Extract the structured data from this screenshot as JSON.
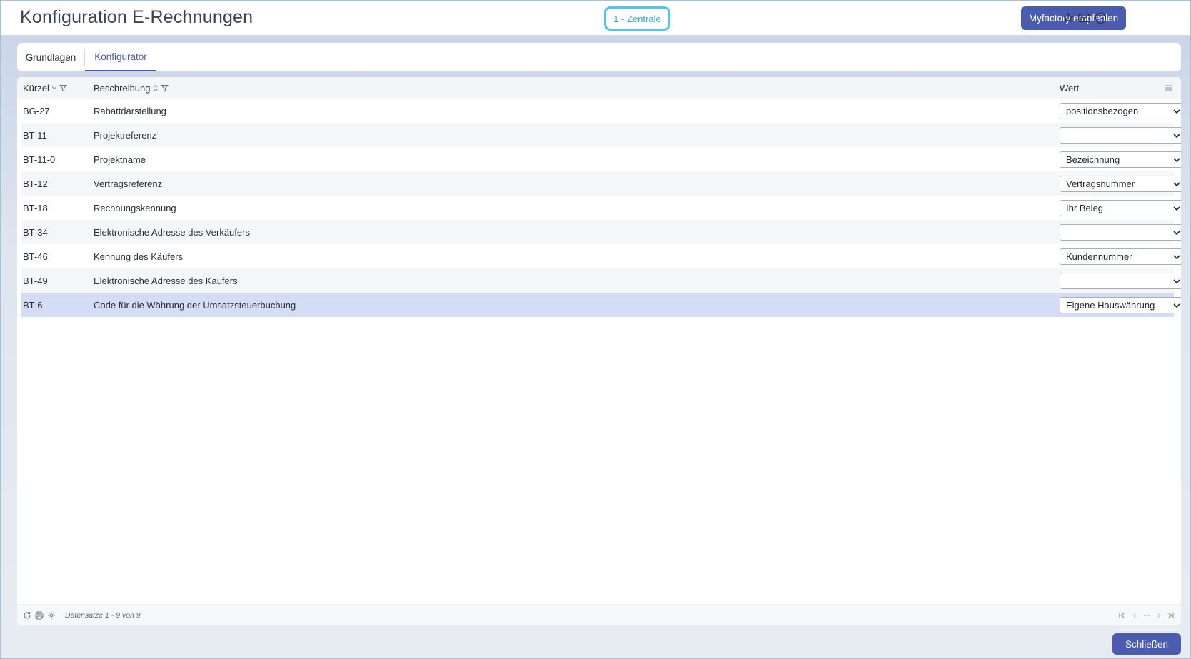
{
  "header": {
    "title": "Konfiguration E-Rechnungen",
    "location": "1 - Zentrale",
    "recommend_label": "Myfactory empfehlen",
    "icons": [
      "star-icon",
      "mail-icon",
      "help-icon"
    ]
  },
  "tabs": [
    {
      "label": "Grundlagen",
      "active": false
    },
    {
      "label": "Konfigurator",
      "active": true
    }
  ],
  "grid": {
    "columns": {
      "kurzel": "Kürzel",
      "beschreibung": "Beschreibung",
      "wert": "Wert"
    },
    "rows": [
      {
        "kurzel": "BG-27",
        "beschreibung": "Rabattdarstellung",
        "wert": "positionsbezogen"
      },
      {
        "kurzel": "BT-11",
        "beschreibung": "Projektreferenz",
        "wert": ""
      },
      {
        "kurzel": "BT-11-0",
        "beschreibung": "Projektname",
        "wert": "Bezeichnung"
      },
      {
        "kurzel": "BT-12",
        "beschreibung": "Vertragsreferenz",
        "wert": "Vertragsnummer"
      },
      {
        "kurzel": "BT-18",
        "beschreibung": "Rechnungskennung",
        "wert": "Ihr Beleg"
      },
      {
        "kurzel": "BT-34",
        "beschreibung": "Elektronische Adresse des Verkäufers",
        "wert": ""
      },
      {
        "kurzel": "BT-46",
        "beschreibung": "Kennung des Käufers",
        "wert": "Kundennummer"
      },
      {
        "kurzel": "BT-49",
        "beschreibung": "Elektronische Adresse des Käufers",
        "wert": ""
      },
      {
        "kurzel": "BT-6",
        "beschreibung": "Code für die Währung der Umsatzsteuerbuchung",
        "wert": "Eigene Hauswährung"
      }
    ],
    "selected_row": 8,
    "record_count": "Datensätze 1 - 9 von 9"
  },
  "footer": {
    "close_label": "Schließen"
  },
  "colors": {
    "accent": "#4a5bb0",
    "badge_border": "#56c3ec",
    "selected_row": "#d5dcf6"
  }
}
